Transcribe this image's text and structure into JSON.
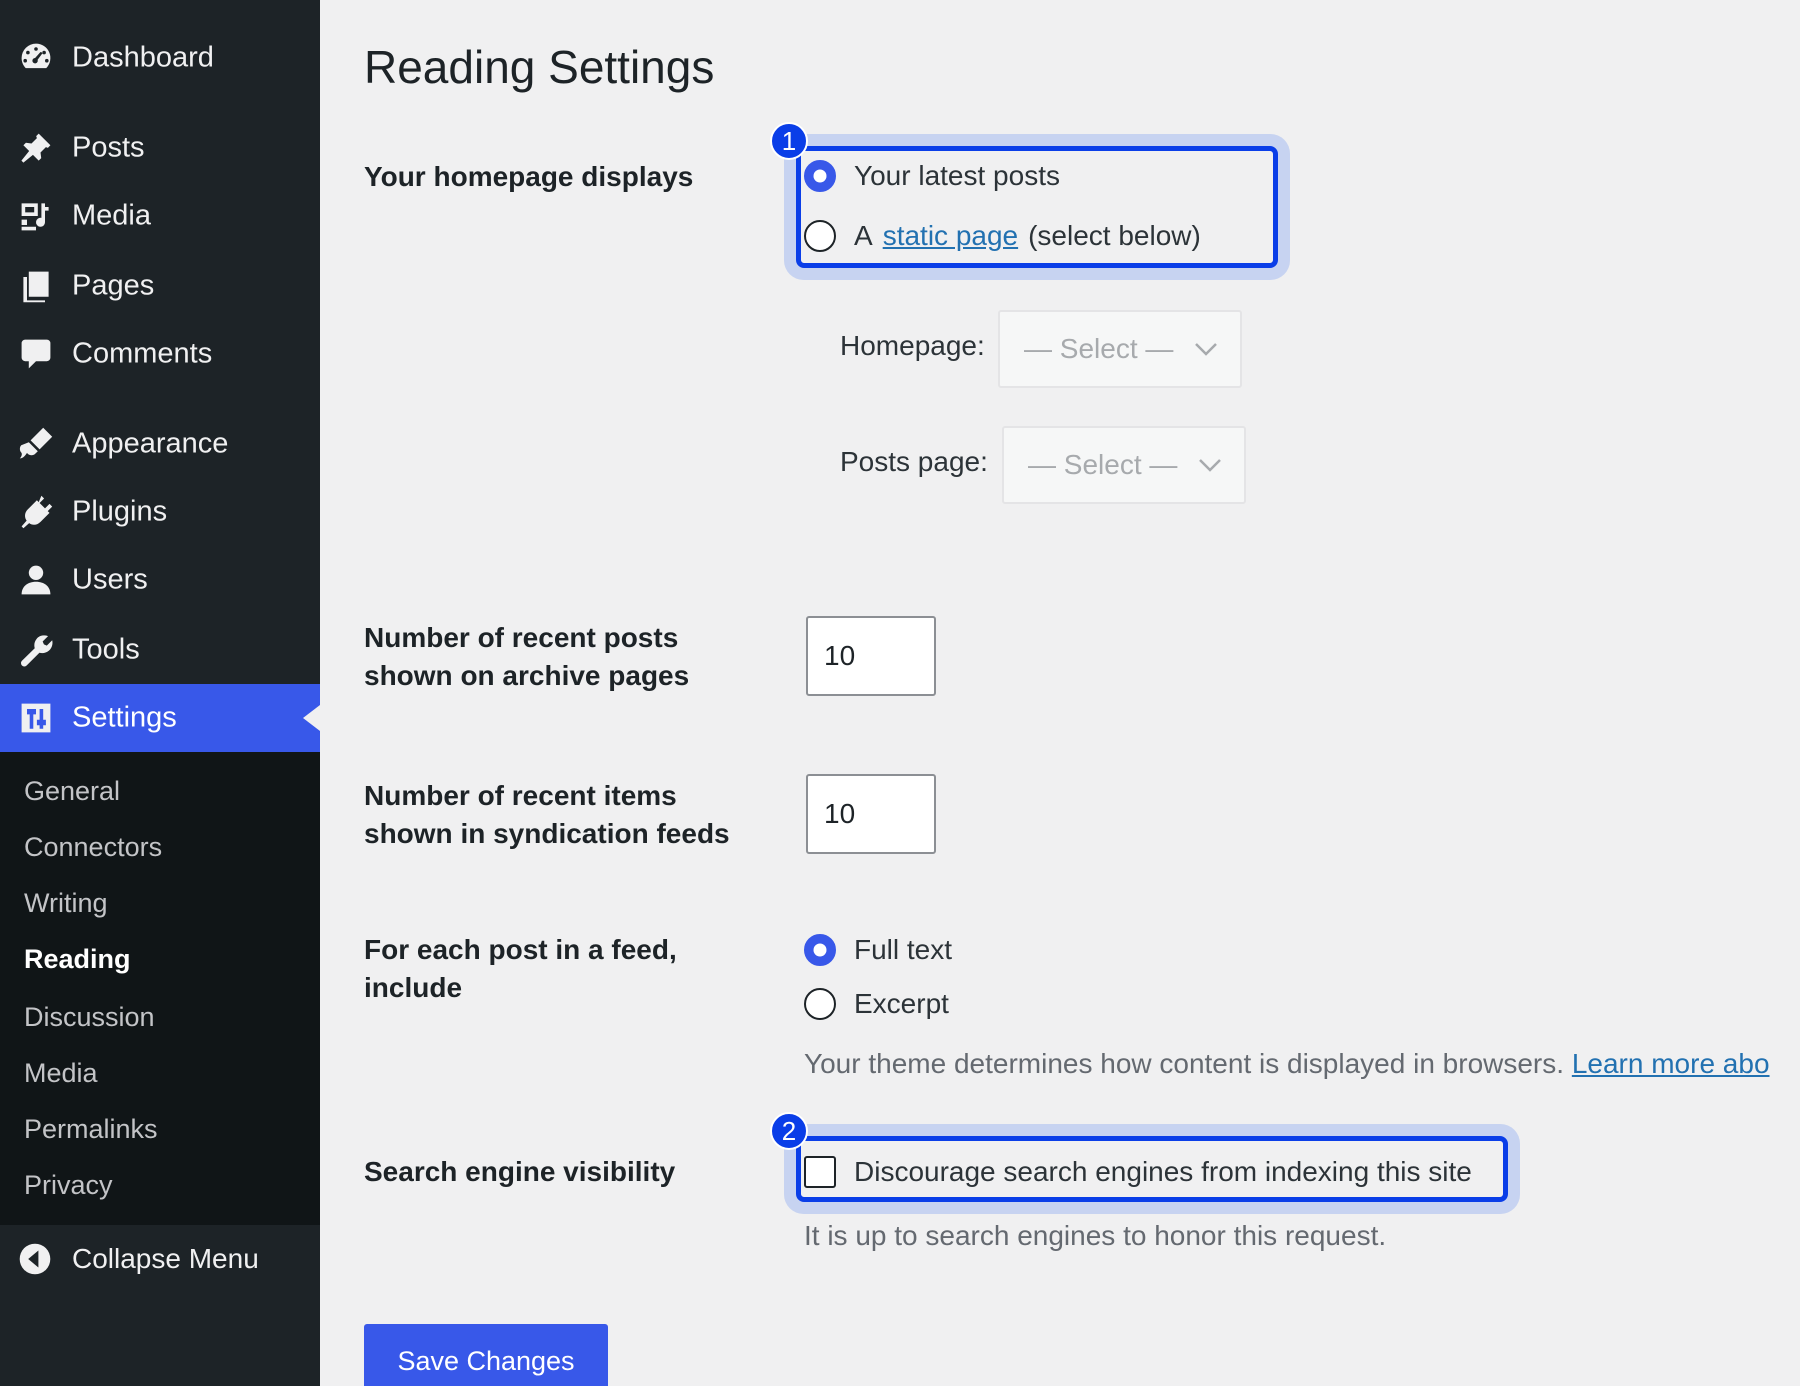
{
  "sidebar": {
    "items": [
      {
        "label": "Dashboard",
        "icon": "dashboard-icon"
      },
      {
        "label": "Posts",
        "icon": "pin-icon"
      },
      {
        "label": "Media",
        "icon": "media-icon"
      },
      {
        "label": "Pages",
        "icon": "pages-icon"
      },
      {
        "label": "Comments",
        "icon": "comment-icon"
      },
      {
        "label": "Appearance",
        "icon": "brush-icon"
      },
      {
        "label": "Plugins",
        "icon": "plugin-icon"
      },
      {
        "label": "Users",
        "icon": "user-icon"
      },
      {
        "label": "Tools",
        "icon": "wrench-icon"
      },
      {
        "label": "Settings",
        "icon": "settings-icon",
        "active": true
      }
    ],
    "submenu": [
      "General",
      "Connectors",
      "Writing",
      "Reading",
      "Discussion",
      "Media",
      "Permalinks",
      "Privacy"
    ],
    "submenu_current": "Reading",
    "collapse_label": "Collapse Menu"
  },
  "page": {
    "title": "Reading Settings"
  },
  "homepage_displays": {
    "label": "Your homepage displays",
    "badge": "1",
    "option_latest": "Your latest posts",
    "option_static_prefix": "A",
    "option_static_link": "static page",
    "option_static_suffix": "(select below)",
    "selected": "latest",
    "homepage_label": "Homepage:",
    "homepage_value": "— Select —",
    "posts_page_label": "Posts page:",
    "posts_page_value": "— Select —"
  },
  "archive_posts": {
    "label_line1": "Number of recent posts",
    "label_line2": "shown on archive pages",
    "value": "10"
  },
  "syndication_items": {
    "label_line1": "Number of recent items",
    "label_line2": "shown in syndication feeds",
    "value": "10"
  },
  "feed_include": {
    "label_line1": "For each post in a feed,",
    "label_line2": "include",
    "option_full": "Full text",
    "option_excerpt": "Excerpt",
    "selected": "full",
    "desc_text": "Your theme determines how content is displayed in browsers.",
    "desc_link": "Learn more abo"
  },
  "search_visibility": {
    "label": "Search engine visibility",
    "badge": "2",
    "checkbox_label": "Discourage search engines from indexing this site",
    "checked": false,
    "desc": "It is up to search engines to honor this request."
  },
  "actions": {
    "save_label": "Save Changes"
  },
  "colors": {
    "accent": "#3858e9",
    "highlight": "#0a3ee8",
    "sidebar_bg": "#1d2327",
    "submenu_bg": "#101517"
  }
}
